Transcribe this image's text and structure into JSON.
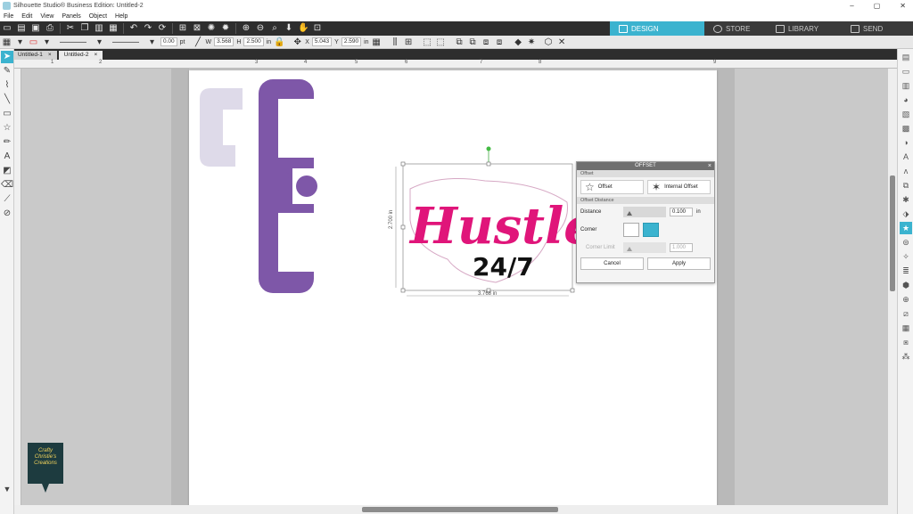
{
  "window": {
    "title": "Silhouette Studio® Business Edition: Untitled-2",
    "controls": [
      "–",
      "▢",
      "✕"
    ]
  },
  "menu": [
    "File",
    "Edit",
    "View",
    "Panels",
    "Object",
    "Help"
  ],
  "tabs": [
    {
      "label": "DESIGN",
      "active": true
    },
    {
      "label": "STORE",
      "active": false
    },
    {
      "label": "LIBRARY",
      "active": false
    },
    {
      "label": "SEND",
      "active": false
    }
  ],
  "toolbar2": {
    "line_width": "0.00",
    "line_unit": "pt",
    "w_label": "W",
    "w_value": "3.568",
    "h_label": "H",
    "h_value": "2.500",
    "size_unit": "in",
    "x_label": "X",
    "x_value": "5.043",
    "y_label": "Y",
    "y_value": "2.590",
    "pos_unit": "in"
  },
  "doc_tabs": [
    {
      "label": "Untitled-1",
      "active": false
    },
    {
      "label": "Untitled-2",
      "active": true
    }
  ],
  "ruler": {
    "marks": [
      "1",
      "2",
      "3",
      "4",
      "5",
      "6",
      "7",
      "8",
      "9"
    ]
  },
  "design": {
    "letters_left": "C",
    "letters_chain": [
      "C",
      "C"
    ],
    "hustle_text": "Hustle",
    "hustle_sub": "24/7",
    "width_readout": "3.768 in",
    "height_readout": "2.700 in"
  },
  "offset_panel": {
    "title": "OFFSET",
    "section_offset": "Offset",
    "offset_label": "Offset",
    "internal_offset_label": "Internal Offset",
    "section_distance": "Offset Distance",
    "distance_label": "Distance",
    "distance_value": "0.100",
    "distance_unit": "in",
    "corner_label": "Corner",
    "corner_limit_label": "Corner Limit",
    "corner_limit_value": "1.000",
    "cancel_label": "Cancel",
    "apply_label": "Apply"
  },
  "logo_text": [
    "Crafty",
    "Christie's",
    "Creations"
  ],
  "colors": {
    "accent": "#3bb3cf",
    "purple": "#7e57a8",
    "lavender": "#dedae9",
    "pink": "#e0157a",
    "dark_toolbar": "#2e2e2e"
  }
}
